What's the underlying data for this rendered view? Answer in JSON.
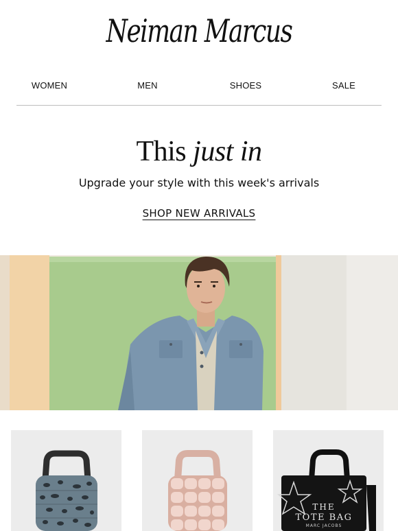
{
  "brand": {
    "logo_text": "Neiman Marcus"
  },
  "nav": {
    "items": [
      {
        "label": "WOMEN"
      },
      {
        "label": "MEN"
      },
      {
        "label": "SHOES"
      },
      {
        "label": "SALE"
      }
    ]
  },
  "hero": {
    "title_regular": "This",
    "title_italic": "just in",
    "subtitle": "Upgrade your style with this week's arrivals",
    "cta_label": "SHOP NEW ARRIVALS"
  },
  "products": [
    {
      "image": "leopard-print-puffer-tote"
    },
    {
      "image": "metallic-pink-puffer-tote"
    },
    {
      "image": "black-star-tote-bag",
      "print_text_1": "THE",
      "print_text_2": "TOTE BAG",
      "print_text_3": "MARC JACOBS"
    }
  ]
}
